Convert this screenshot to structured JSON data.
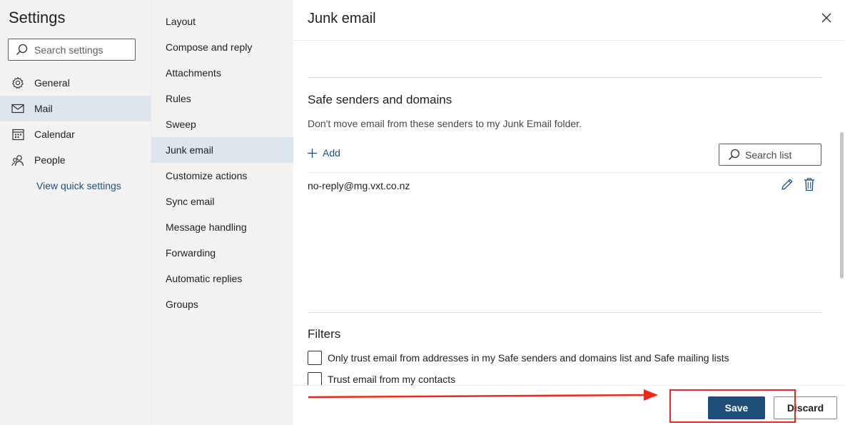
{
  "nav": {
    "title": "Settings",
    "search_placeholder": "Search settings",
    "items": [
      {
        "label": "General",
        "icon": "gear-icon"
      },
      {
        "label": "Mail",
        "icon": "mail-icon",
        "selected": true
      },
      {
        "label": "Calendar",
        "icon": "calendar-icon"
      },
      {
        "label": "People",
        "icon": "people-icon"
      }
    ],
    "quick_settings": "View quick settings"
  },
  "submenu": {
    "items": [
      "Layout",
      "Compose and reply",
      "Attachments",
      "Rules",
      "Sweep",
      "Junk email",
      "Customize actions",
      "Sync email",
      "Message handling",
      "Forwarding",
      "Automatic replies",
      "Groups"
    ],
    "selected": "Junk email"
  },
  "content": {
    "title": "Junk email",
    "safe_senders": {
      "title": "Safe senders and domains",
      "description": "Don't move email from these senders to my Junk Email folder.",
      "add_label": "Add",
      "search_list_label": "Search list",
      "entries": [
        "no-reply@mg.vxt.co.nz"
      ]
    },
    "filters": {
      "title": "Filters",
      "options": [
        {
          "label": "Only trust email from addresses in my Safe senders and domains list and Safe mailing lists",
          "checked": false
        },
        {
          "label": "Trust email from my contacts",
          "checked": false
        }
      ]
    },
    "footer": {
      "save_label": "Save",
      "discard_label": "Discard"
    }
  },
  "colors": {
    "accent": "#1f4e79",
    "link": "#1a4f82",
    "selected_bg": "#dde6ef",
    "annotation": "#e8291c"
  }
}
